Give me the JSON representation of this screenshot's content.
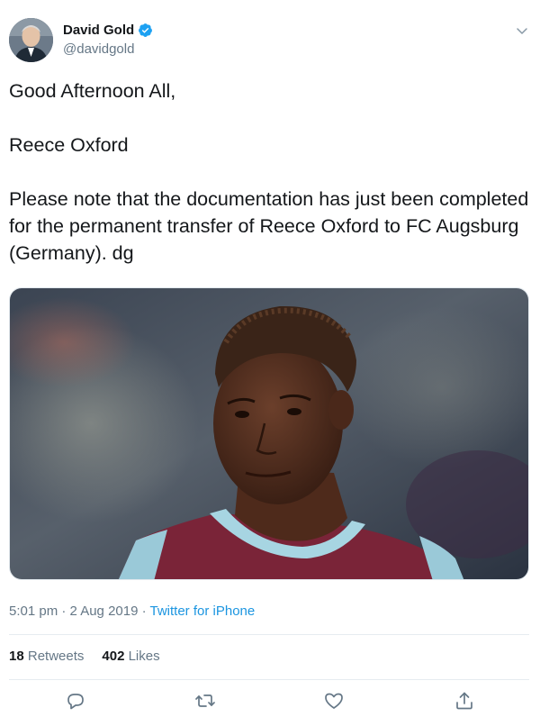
{
  "author": {
    "name": "David Gold",
    "handle": "@davidgold",
    "verified": true
  },
  "tweet": {
    "lines": [
      "Good Afternoon All,",
      "Reece Oxford",
      "Please note that the documentation has just been completed for the permanent transfer of Reece Oxford to FC Augsburg (Germany).  dg"
    ]
  },
  "meta": {
    "time": "5:01 pm · 2 Aug 2019 · ",
    "source": "Twitter for iPhone"
  },
  "stats": {
    "retweets_count": "18",
    "retweets_label": "Retweets",
    "likes_count": "402",
    "likes_label": "Likes"
  },
  "icons": {
    "verified": "verified-badge-icon",
    "caret": "chevron-down-icon",
    "reply": "reply-icon",
    "retweet": "retweet-icon",
    "like": "heart-icon",
    "share": "share-icon"
  },
  "colors": {
    "link": "#1b95e0",
    "secondary_text": "#657786",
    "divider": "#e6ecf0"
  }
}
